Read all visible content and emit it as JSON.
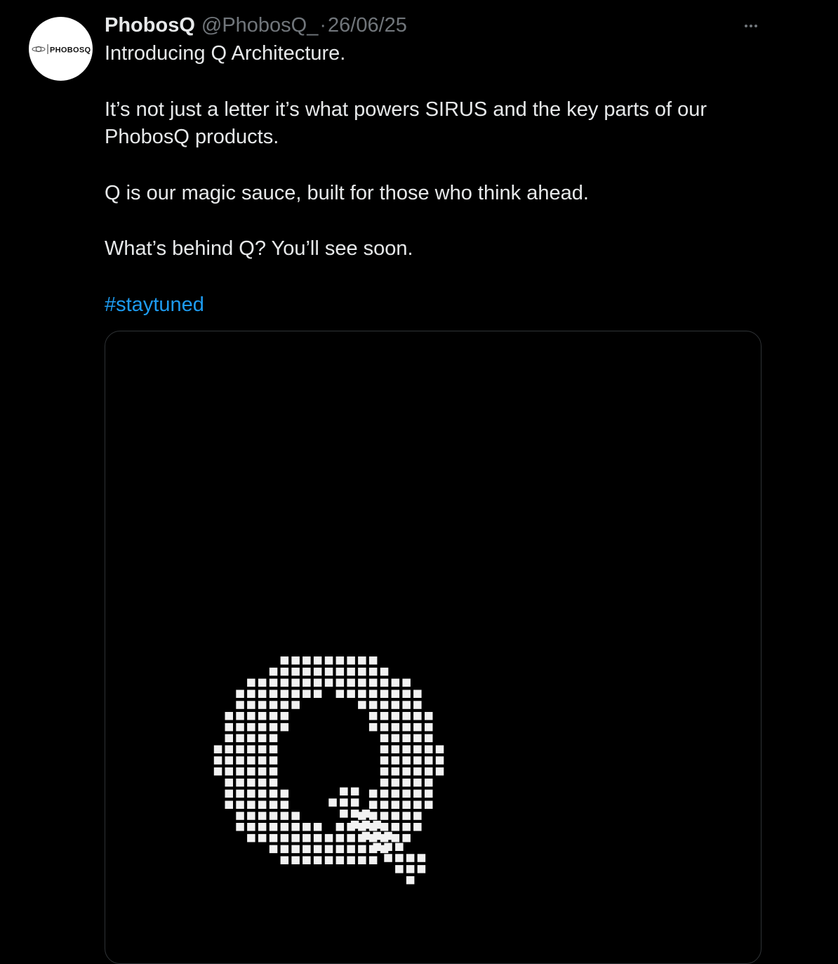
{
  "tweet": {
    "author": {
      "display_name": "PhobosQ",
      "handle": "@PhobosQ_",
      "avatar_logo_text": "PHOBOSQ"
    },
    "separator": "·",
    "timestamp": "26/06/25",
    "more_icon": "more-horizontal-icon",
    "body": {
      "line1": "Introducing Q Architecture.",
      "line2": "It’s not just a letter it’s what powers SIRUS and the key parts of our",
      "line3": "PhobosQ products.",
      "line4": "Q is our magic sauce, built for those who think ahead.",
      "line5": "What’s behind Q? You’ll see soon.",
      "hashtag": "#staytuned"
    },
    "media": {
      "description_icon": "pixel-q-logo",
      "tile_color": "#f2f2f2"
    }
  },
  "colors": {
    "background": "#000000",
    "text_primary": "#e7e9ea",
    "text_secondary": "#71767b",
    "link": "#1d9bf0",
    "border": "#2f3336"
  }
}
